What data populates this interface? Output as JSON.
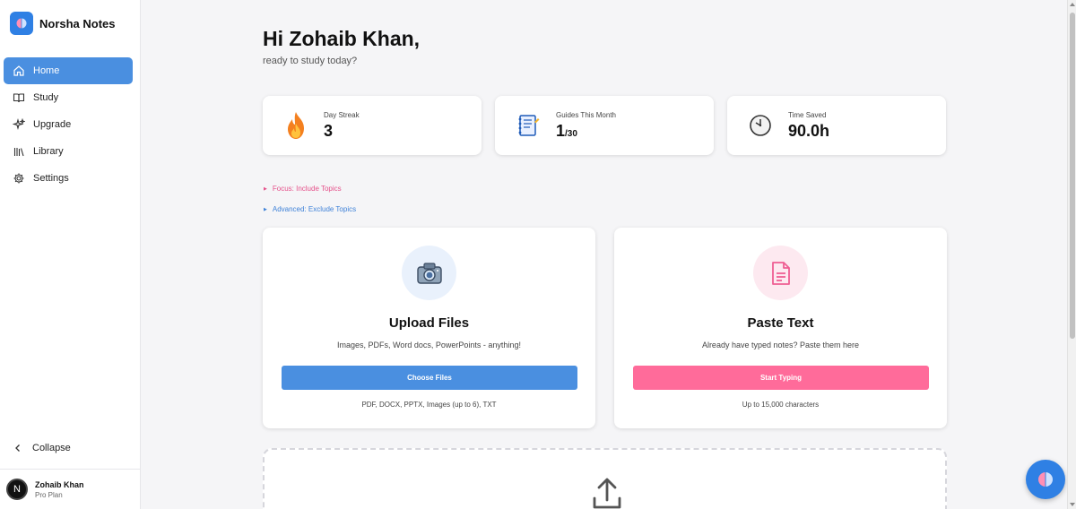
{
  "app": {
    "name": "Norsha Notes",
    "brand_color": "#2f80e4"
  },
  "sidebar": {
    "items": [
      {
        "label": "Home",
        "icon": "home-icon",
        "active": true
      },
      {
        "label": "Study",
        "icon": "book-icon"
      },
      {
        "label": "Upgrade",
        "icon": "sparkles-icon"
      },
      {
        "label": "Library",
        "icon": "library-icon"
      },
      {
        "label": "Settings",
        "icon": "gear-icon"
      }
    ],
    "collapse_label": "Collapse",
    "user": {
      "initial": "N",
      "name": "Zohaib Khan",
      "plan": "Pro Plan"
    }
  },
  "main": {
    "greeting": "Hi Zohaib Khan,",
    "subtitle": "ready to study today?",
    "stats": [
      {
        "label": "Day Streak",
        "value": "3",
        "icon": "fire-icon"
      },
      {
        "label": "Guides This Month",
        "value": "1",
        "suffix": "/30",
        "icon": "notebook-icon"
      },
      {
        "label": "Time Saved",
        "value": "90.0h",
        "icon": "clock-icon"
      }
    ],
    "focus_link": "Focus: Include Topics",
    "advanced_link": "Advanced: Exclude Topics",
    "upload_card": {
      "title": "Upload Files",
      "description": "Images, PDFs, Word docs, PowerPoints - anything!",
      "button": "Choose Files",
      "note": "PDF, DOCX, PPTX, Images (up to 6), TXT",
      "accent": "#4a8fe0"
    },
    "paste_card": {
      "title": "Paste Text",
      "description": "Already have typed notes? Paste them here",
      "button": "Start Typing",
      "note": "Up to 15,000 characters",
      "accent": "#ff6b9a"
    }
  }
}
